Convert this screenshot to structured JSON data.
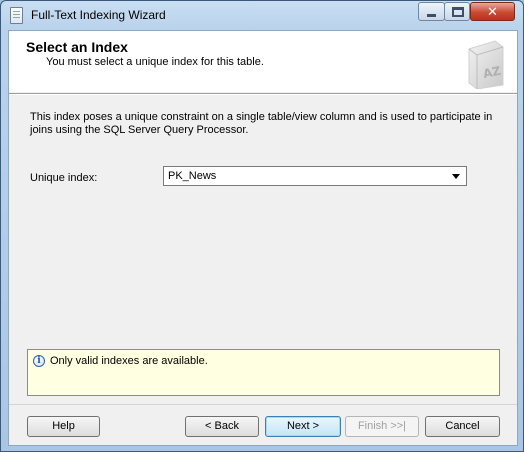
{
  "window": {
    "title": "Full-Text Indexing Wizard",
    "close_glyph": "✕",
    "colors": {
      "frame": "#b9d3ec",
      "info_background": "#ffffe1"
    }
  },
  "header": {
    "title": "Select an Index",
    "subtitle": "You must select a unique index for this table.",
    "icon": "book-az-icon"
  },
  "main": {
    "description": "This index poses a unique constraint on a single table/view column and is used to participate in joins using the SQL Server Query Processor.",
    "unique_index_label": "Unique index:",
    "unique_index_value": "PK_News"
  },
  "info": {
    "icon": "info-icon",
    "icon_glyph": "i",
    "message": "Only valid indexes are available."
  },
  "buttons": {
    "help": "Help",
    "back": "< Back",
    "next": "Next >",
    "finish": "Finish >>|",
    "cancel": "Cancel"
  }
}
